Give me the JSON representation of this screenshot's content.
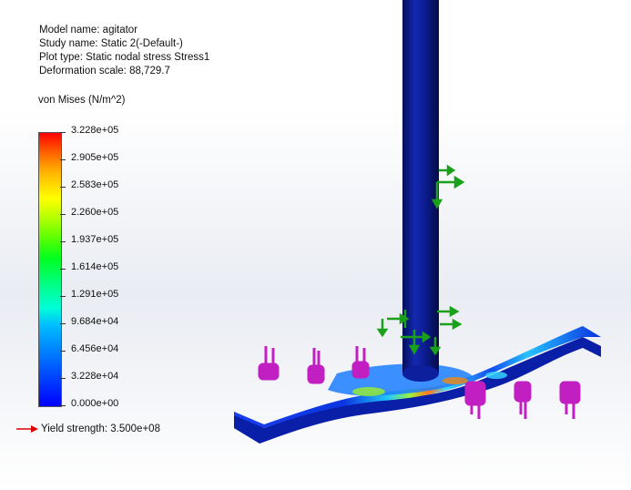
{
  "info": {
    "model_name": "Model name: agitator",
    "study_name": "Study name: Static 2(-Default-)",
    "plot_type": "Plot type: Static nodal stress Stress1",
    "deformation_scale": "Deformation scale: 88,729.7"
  },
  "legend": {
    "units": "von Mises (N/m^2)",
    "ticks": [
      "3.228e+05",
      "2.905e+05",
      "2.583e+05",
      "2.260e+05",
      "1.937e+05",
      "1.614e+05",
      "1.291e+05",
      "9.684e+04",
      "6.456e+04",
      "3.228e+04",
      "0.000e+00"
    ],
    "yield_strength": "Yield strength: 3.500e+08"
  },
  "colors": {
    "shaft": "#0a1a8c",
    "paddle": "#0b2fd6",
    "fixture_arrow": "#1aa01a",
    "load_arrow": "#c21fc2",
    "yield_arrow": "#e00000"
  }
}
